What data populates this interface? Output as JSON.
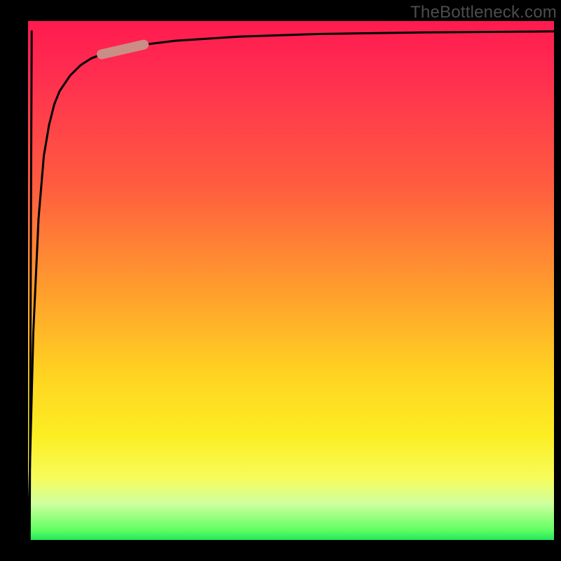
{
  "watermark": "TheBottleneck.com",
  "chart_data": {
    "type": "line",
    "title": "",
    "xlabel": "",
    "ylabel": "",
    "x": [
      0,
      1,
      2,
      3,
      4,
      5,
      6,
      8,
      10,
      12,
      15,
      20,
      28,
      40,
      55,
      75,
      100
    ],
    "values": [
      0,
      40,
      62,
      74,
      80,
      84,
      86.5,
      89.5,
      91.5,
      92.8,
      94,
      95.2,
      96.2,
      97,
      97.5,
      97.8,
      98
    ],
    "xlim": [
      0,
      100
    ],
    "ylim": [
      0,
      100
    ],
    "highlight_segment": {
      "x_start": 14,
      "x_end": 22,
      "note": "rounded capsule marker on the curve"
    },
    "background_gradient": {
      "orientation": "vertical",
      "stops": [
        {
          "pos": 0.0,
          "color": "#ff1a4f"
        },
        {
          "pos": 0.32,
          "color": "#ff5d3f"
        },
        {
          "pos": 0.52,
          "color": "#ff9e2d"
        },
        {
          "pos": 0.68,
          "color": "#ffd321"
        },
        {
          "pos": 0.88,
          "color": "#f7fc5a"
        },
        {
          "pos": 0.98,
          "color": "#63ff63"
        },
        {
          "pos": 1.0,
          "color": "#23e85c"
        }
      ]
    }
  }
}
